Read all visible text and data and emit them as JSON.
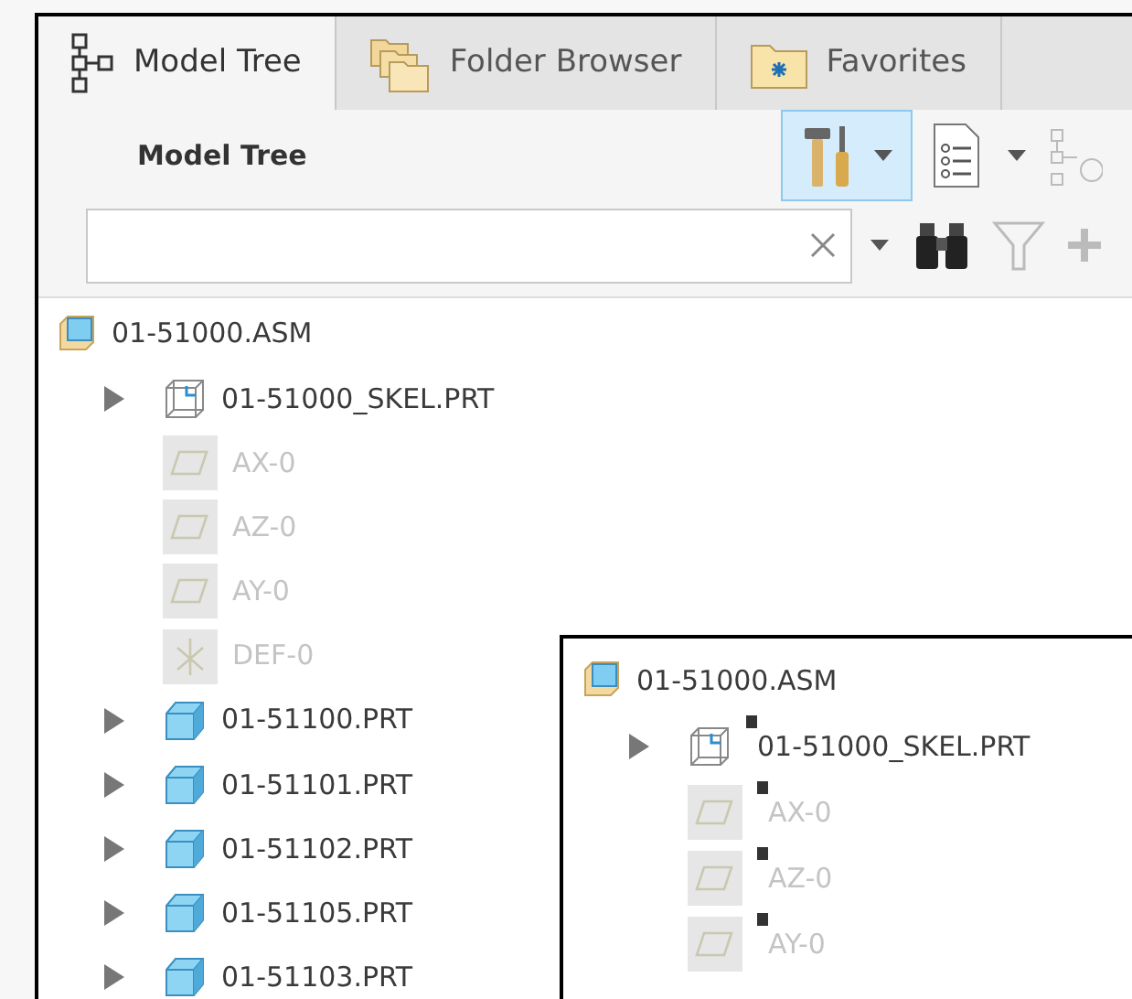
{
  "tabs": [
    {
      "label": "Model Tree",
      "kind": "tree",
      "selected": true
    },
    {
      "label": "Folder Browser",
      "kind": "folders",
      "selected": false
    },
    {
      "label": "Favorites",
      "kind": "favorites",
      "selected": false
    }
  ],
  "toolbar": {
    "title": "Model Tree"
  },
  "tree": [
    {
      "label": "01-51000.ASM",
      "kind": "assembly",
      "expandable": false,
      "dimmed": false,
      "indent": false
    },
    {
      "label": "01-51000_SKEL.PRT",
      "kind": "skeleton",
      "expandable": true,
      "dimmed": false,
      "indent": true
    },
    {
      "label": "AX-0",
      "kind": "plane",
      "expandable": false,
      "dimmed": true,
      "indent": true
    },
    {
      "label": "AZ-0",
      "kind": "plane",
      "expandable": false,
      "dimmed": true,
      "indent": true
    },
    {
      "label": "AY-0",
      "kind": "plane",
      "expandable": false,
      "dimmed": true,
      "indent": true
    },
    {
      "label": "DEF-0",
      "kind": "csys",
      "expandable": false,
      "dimmed": true,
      "indent": true
    },
    {
      "label": "01-51100.PRT",
      "kind": "part",
      "expandable": true,
      "dimmed": false,
      "indent": true
    },
    {
      "label": "01-51101.PRT",
      "kind": "part",
      "expandable": true,
      "dimmed": false,
      "indent": true
    },
    {
      "label": "01-51102.PRT",
      "kind": "part",
      "expandable": true,
      "dimmed": false,
      "indent": true
    },
    {
      "label": "01-51105.PRT",
      "kind": "part",
      "expandable": true,
      "dimmed": false,
      "indent": true
    },
    {
      "label": "01-51103.PRT",
      "kind": "part",
      "expandable": true,
      "dimmed": false,
      "indent": true
    }
  ],
  "inset_tree": [
    {
      "label": "01-51000.ASM",
      "kind": "assembly",
      "expandable": false,
      "dimmed": false,
      "indent": false,
      "marker": false
    },
    {
      "label": "01-51000_SKEL.PRT",
      "kind": "skeleton",
      "expandable": true,
      "dimmed": false,
      "indent": true,
      "marker": true
    },
    {
      "label": "AX-0",
      "kind": "plane",
      "expandable": false,
      "dimmed": true,
      "indent": true,
      "marker": true
    },
    {
      "label": "AZ-0",
      "kind": "plane",
      "expandable": false,
      "dimmed": true,
      "indent": true,
      "marker": true
    },
    {
      "label": "AY-0",
      "kind": "plane",
      "expandable": false,
      "dimmed": true,
      "indent": true,
      "marker": true
    }
  ]
}
